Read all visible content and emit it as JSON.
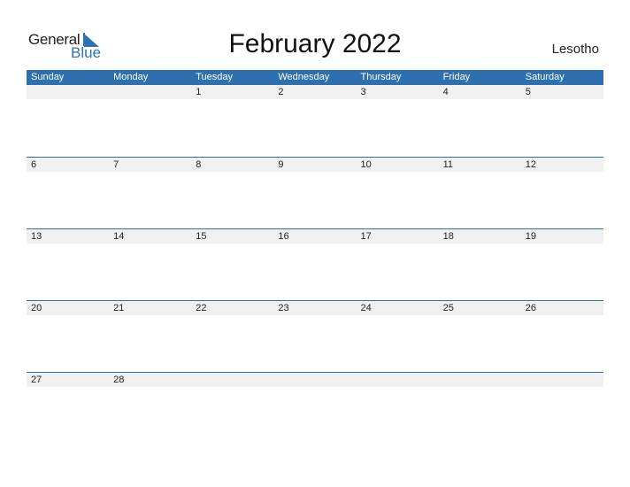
{
  "logo": {
    "line1": "General",
    "line2": "Blue"
  },
  "title": "February 2022",
  "country": "Lesotho",
  "colors": {
    "accent": "#2e6fb0",
    "strip": "#f0f0f0"
  },
  "weekdays": [
    "Sunday",
    "Monday",
    "Tuesday",
    "Wednesday",
    "Thursday",
    "Friday",
    "Saturday"
  ],
  "weeks": [
    [
      "",
      "",
      "1",
      "2",
      "3",
      "4",
      "5"
    ],
    [
      "6",
      "7",
      "8",
      "9",
      "10",
      "11",
      "12"
    ],
    [
      "13",
      "14",
      "15",
      "16",
      "17",
      "18",
      "19"
    ],
    [
      "20",
      "21",
      "22",
      "23",
      "24",
      "25",
      "26"
    ],
    [
      "27",
      "28",
      "",
      "",
      "",
      "",
      ""
    ]
  ]
}
